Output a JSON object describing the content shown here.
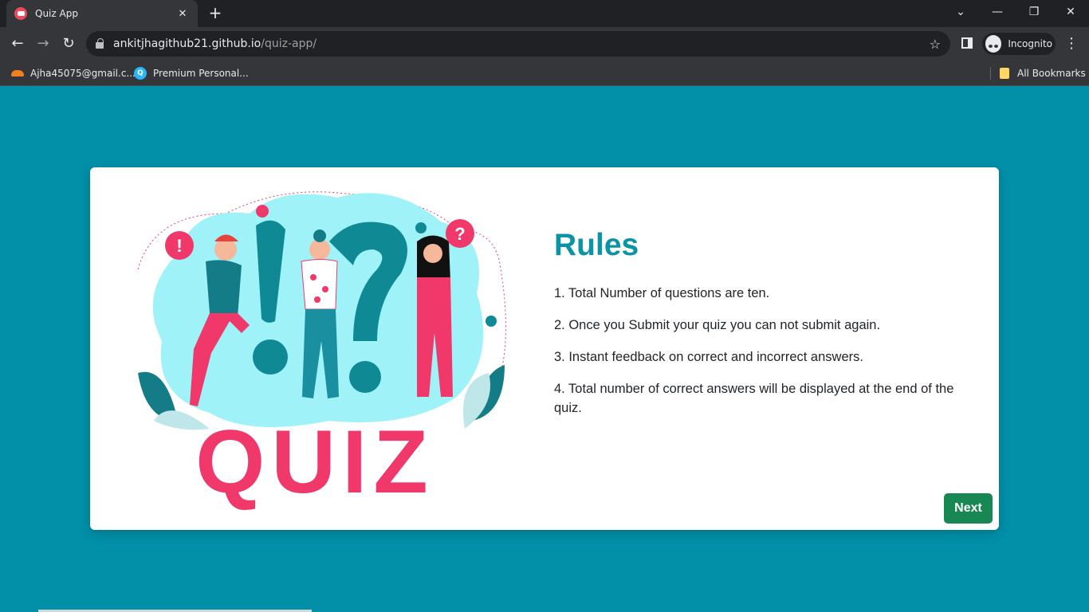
{
  "browser": {
    "tab_title": "Quiz App",
    "url_host": "ankitjhagithub21.github.io",
    "url_path": "/quiz-app/",
    "profile_label": "Incognito",
    "bookmarks": [
      {
        "label": "Ajha45075@gmail.c..."
      },
      {
        "label": "Premium Personal..."
      }
    ],
    "all_bookmarks_label": "All Bookmarks"
  },
  "page": {
    "rules_title": "Rules",
    "rules": [
      "1. Total Number of questions are ten.",
      "2. Once you Submit your quiz you can not submit again.",
      "3. Instant feedback on correct and incorrect answers.",
      "4. Total number of correct answers will be displayed at the end of the quiz."
    ],
    "next_label": "Next",
    "illustration_word": "QUIZ"
  },
  "colors": {
    "background": "#0190a8",
    "title": "#0b93a7",
    "next_button": "#198754",
    "quiz_pink": "#f0386b"
  }
}
